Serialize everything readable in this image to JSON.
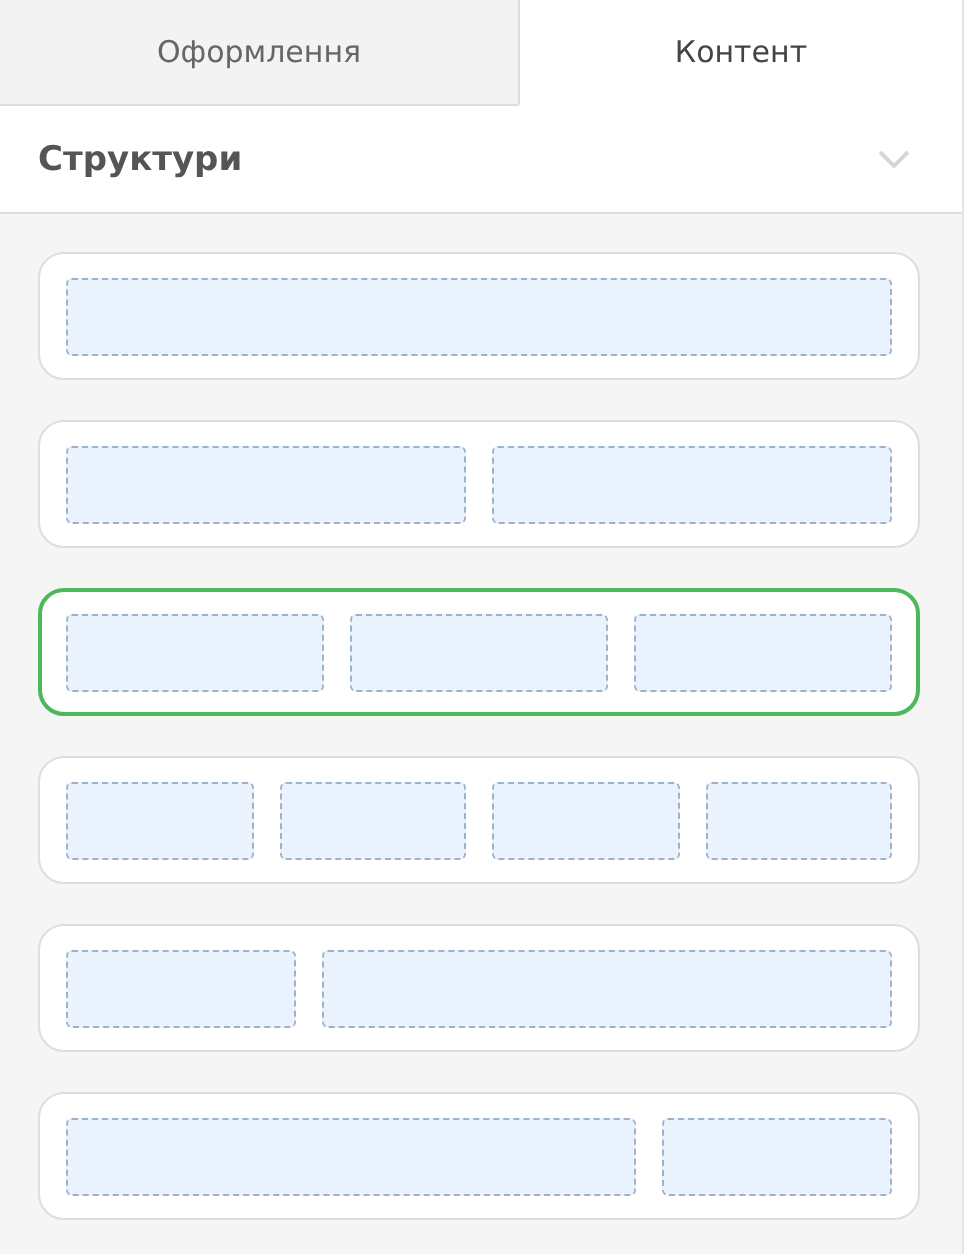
{
  "tabs": [
    {
      "label": "Оформлення",
      "selected": false
    },
    {
      "label": "Контент",
      "selected": true
    }
  ],
  "section": {
    "title": "Структури",
    "expanded": true
  },
  "structures": [
    {
      "kind": "single",
      "selected": false
    },
    {
      "kind": "halves",
      "selected": false
    },
    {
      "kind": "thirds",
      "selected": true
    },
    {
      "kind": "quarters",
      "selected": false
    },
    {
      "kind": "narrowwide",
      "selected": false
    },
    {
      "kind": "widenarrow",
      "selected": false
    }
  ]
}
